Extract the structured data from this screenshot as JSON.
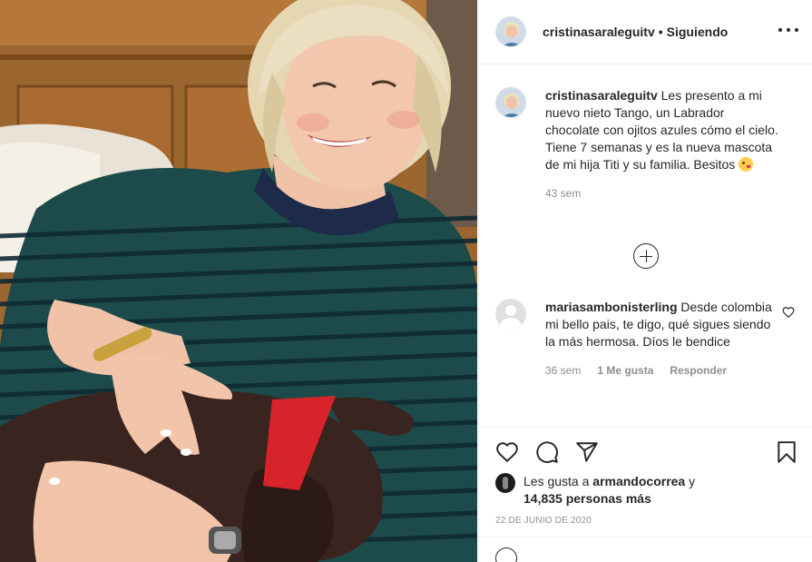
{
  "post": {
    "username": "cristinasaraleguitv",
    "separator": "•",
    "follow_status": "Siguiendo",
    "caption_text": "Les presento a mi nuevo nieto Tango, un Labrador chocolate con ojitos azules cómo el cielo. Tiene 7 semanas y es la nueva mascota de mi hija Titi y su familia. Besitos",
    "caption_time": "43 sem",
    "date": "22 DE JUNIO DE 2020"
  },
  "comments": [
    {
      "username": "mariasambonisterling",
      "text": "Desde colombia mi bello pais, te digo, qué sigues siendo la más hermosa. Díos le bendice",
      "time": "36 sem",
      "likes": "1 Me gusta",
      "reply": "Responder"
    }
  ],
  "likes": {
    "prefix": "Les gusta a",
    "user": "armandocorrea",
    "joiner": "y",
    "others": "14,835 personas más"
  },
  "icons": {
    "header_more": "more-options-icon",
    "load_more": "plus-circle-icon",
    "comment_like": "heart-icon",
    "like": "heart-icon",
    "comment": "comment-bubble-icon",
    "share": "paper-plane-icon",
    "save": "bookmark-icon",
    "emoji": "kiss-face-emoji"
  },
  "colors": {
    "text": "#262626",
    "secondary": "#8e8e8e",
    "border": "#efefef"
  }
}
